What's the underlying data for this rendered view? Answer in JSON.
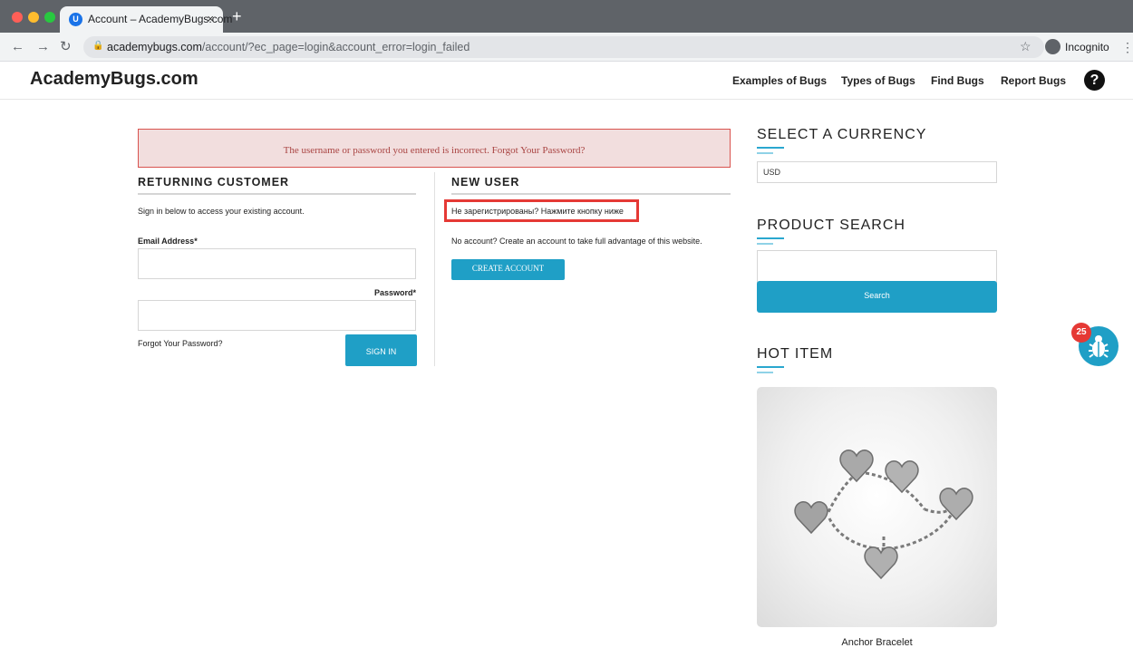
{
  "browser": {
    "tab_title": "Account – AcademyBugs.com",
    "tab_close": "×",
    "new_tab": "+",
    "favicon_letter": "U",
    "url_host": "academybugs.com",
    "url_path": "/account/?ec_page=login&account_error=login_failed",
    "incognito_label": "Incognito"
  },
  "header": {
    "logo": "AcademyBugs.com",
    "nav": [
      "Examples of Bugs",
      "Types of Bugs",
      "Find Bugs",
      "Report Bugs"
    ],
    "help_glyph": "?"
  },
  "alert": {
    "text": "The username or password you entered is incorrect. Forgot Your Password?"
  },
  "returning": {
    "title": "RETURNING CUSTOMER",
    "intro": "Sign in below to access your existing account.",
    "email_label": "Email Address*",
    "email_value": "",
    "password_label": "Password*",
    "password_value": "",
    "forgot": "Forgot Your Password?",
    "signin": "SIGN IN"
  },
  "new_user": {
    "title": "NEW USER",
    "russian_text": "Не зарегистрированы? Нажмите кнопку ниже",
    "no_account": "No account? Create an account to take full advantage of this website.",
    "create": "CREATE ACCOUNT"
  },
  "sidebar": {
    "currency_title": "SELECT A CURRENCY",
    "currency_value": "USD",
    "search_title": "PRODUCT SEARCH",
    "search_value": "",
    "search_button": "Search",
    "hot_title": "HOT ITEM",
    "hot_caption": "Anchor Bracelet"
  },
  "bug_widget": {
    "count": "25"
  },
  "colors": {
    "accent": "#1f9fc6",
    "alert_bg": "#f2dede",
    "alert_text": "#a94442",
    "highlight": "#e53935"
  }
}
